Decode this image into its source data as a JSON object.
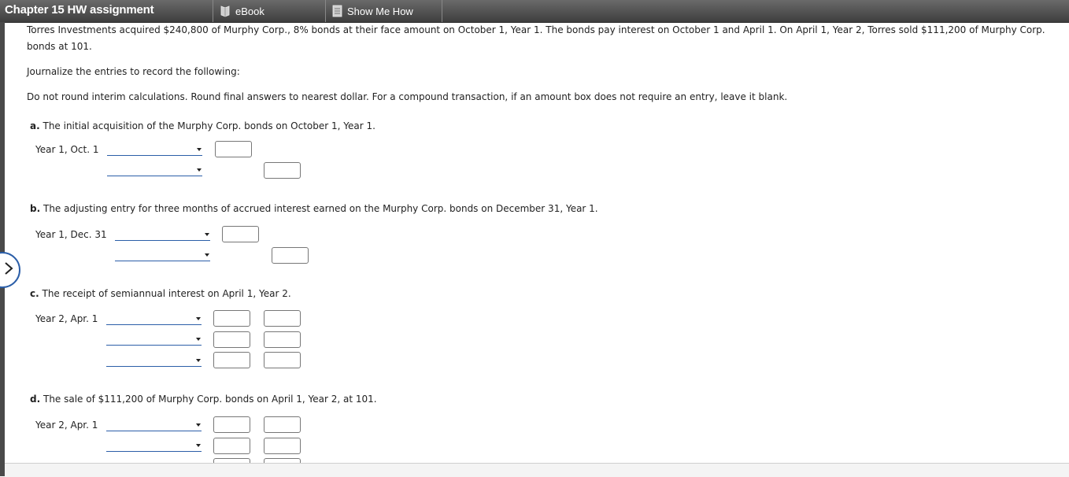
{
  "header": {
    "title": "Chapter 15 HW assignment",
    "tabs": [
      {
        "label": "eBook",
        "icon": "book-icon"
      },
      {
        "label": "Show Me How",
        "icon": "document-icon"
      }
    ]
  },
  "problem": {
    "line1": "Torres Investments acquired $240,800 of Murphy Corp., 8% bonds at their face amount on October 1, Year 1. The bonds pay interest on October 1 and April 1. On April 1, Year 2, Torres sold $111,200 of Murphy Corp.",
    "line2": "bonds at 101.",
    "instruction": "Journalize the entries to record the following:",
    "rounding": "Do not round interim calculations. Round final answers to nearest dollar. For a compound transaction, if an amount box does not require an entry, leave it blank."
  },
  "parts": {
    "a": {
      "letter": "a.",
      "text": "The initial acquisition of the Murphy Corp. bonds on October 1, Year 1.",
      "date": "Year 1, Oct. 1"
    },
    "b": {
      "letter": "b.",
      "text": "The adjusting entry for three months of accrued interest earned on the Murphy Corp. bonds on December 31, Year 1.",
      "date": "Year 1, Dec. 31"
    },
    "c": {
      "letter": "c.",
      "text": "The receipt of semiannual interest on April 1, Year 2.",
      "date": "Year 2, Apr. 1"
    },
    "d": {
      "letter": "d.",
      "text": "The sale of $111,200 of Murphy Corp. bonds on April 1, Year 2, at 101.",
      "date": "Year 2, Apr. 1"
    }
  },
  "colors": {
    "accent": "#2b5ea8",
    "header_bg": "#4e4e4e"
  }
}
